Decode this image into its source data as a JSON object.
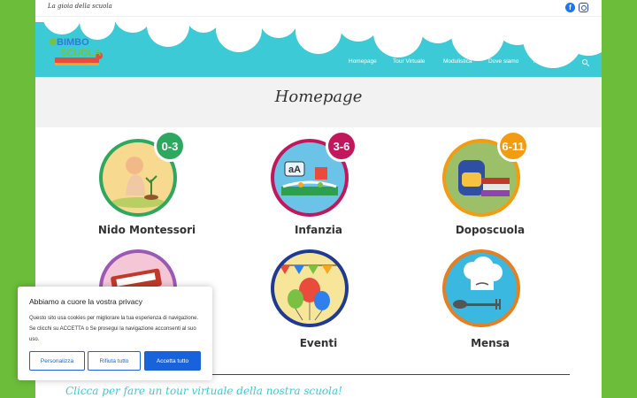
{
  "topbar": {
    "tagline": "La gioia della scuola"
  },
  "logo": {
    "line1": "BIMBO",
    "line2": "SCUOLA"
  },
  "nav": {
    "items": [
      "Homepage",
      "Tour Virtuale",
      "Modulistica",
      "Dove siamo",
      "la scuola"
    ],
    "dropdown_glyph": "⌄"
  },
  "page": {
    "title": "Homepage"
  },
  "cards": [
    {
      "label": "Nido Montessori",
      "badge": "0-3"
    },
    {
      "label": "Infanzia",
      "badge": "3-6"
    },
    {
      "label": "Doposcuola",
      "badge": "6-11"
    },
    {
      "label": "",
      "badge": ""
    },
    {
      "label": "Eventi",
      "badge": ""
    },
    {
      "label": "Mensa",
      "badge": ""
    }
  ],
  "colors": {
    "background": "#6cbd3a",
    "header": "#3ccbd6",
    "accent": "#1863dc"
  },
  "cookie": {
    "title": "Abbiamo a cuore la vostra privacy",
    "text": "Questo sito usa cookies per migliorare la tua esperienza di navigazione. Se clicchi su ACCETTA o Se prosegui la navigazione acconsenti al suo uso.",
    "customize": "Personalizza",
    "reject": "Rifiuta tutto",
    "accept": "Accetta tutto"
  },
  "tour": {
    "text": "Clicca per fare un tour virtuale della nostra scuola!"
  }
}
